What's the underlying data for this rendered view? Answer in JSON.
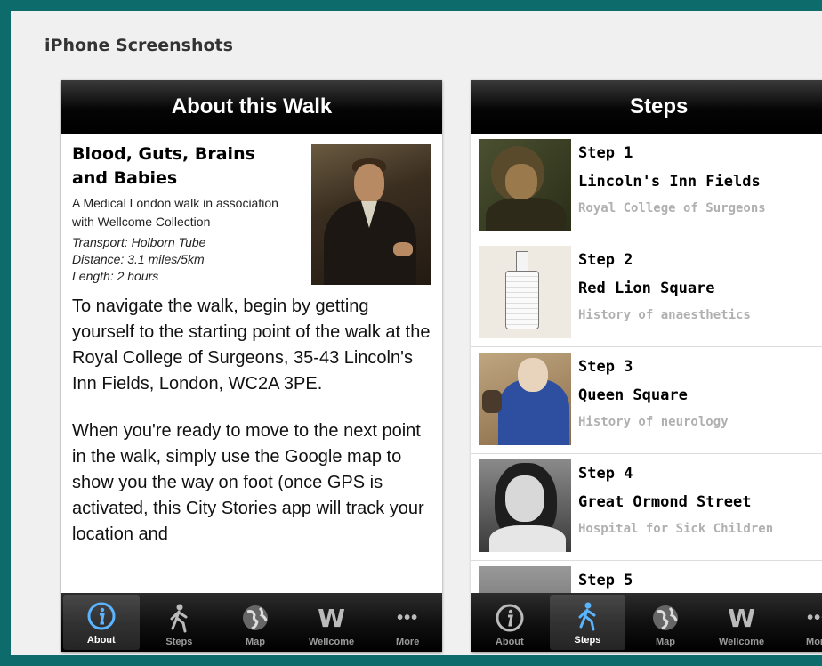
{
  "page": {
    "title": "iPhone Screenshots"
  },
  "about_screen": {
    "nav_title": "About this Walk",
    "walk_title": "Blood, Guts, Brains and Babies",
    "subtitle": "A Medical London walk in association with Wellcome Collection",
    "transport": "Transport: Holborn Tube",
    "distance": "Distance: 3.1 miles/5km",
    "length": "Length: 2 hours",
    "paragraph_1": "To navigate the walk, begin by getting yourself to the starting point of the walk at the Royal College of Surgeons, 35-43 Lincoln's Inn Fields, London, WC2A 3PE.",
    "paragraph_2": "When you're ready to move to the next point in the walk, simply use the Google map to show you the way on foot (once GPS is activated, this City Stories app will track your location and"
  },
  "steps_screen": {
    "nav_title": "Steps",
    "steps": [
      {
        "number": "Step 1",
        "name": "Lincoln's Inn Fields",
        "description": "Royal College of Surgeons"
      },
      {
        "number": "Step 2",
        "name": "Red Lion Square",
        "description": "History of anaesthetics"
      },
      {
        "number": "Step 3",
        "name": "Queen Square",
        "description": "History of neurology"
      },
      {
        "number": "Step 4",
        "name": "Great Ormond Street",
        "description": "Hospital for Sick Children"
      },
      {
        "number": "Step 5",
        "name": "",
        "description": ""
      }
    ],
    "chevron": "›"
  },
  "tabs": [
    {
      "label": "About",
      "icon": "info-icon"
    },
    {
      "label": "Steps",
      "icon": "walker-icon"
    },
    {
      "label": "Map",
      "icon": "globe-icon"
    },
    {
      "label": "Wellcome",
      "icon": "wellcome-w-icon"
    },
    {
      "label": "More",
      "icon": "more-dots-icon"
    }
  ],
  "tabs_glyph": {
    "wellcome": "W",
    "more": "•••"
  },
  "colors": {
    "frame": "#0d6b6b",
    "tab_active_blue": "#5ab4ff",
    "nav_black": "#000000"
  },
  "active_tab": {
    "about_screen": "About",
    "steps_screen": "Steps"
  }
}
